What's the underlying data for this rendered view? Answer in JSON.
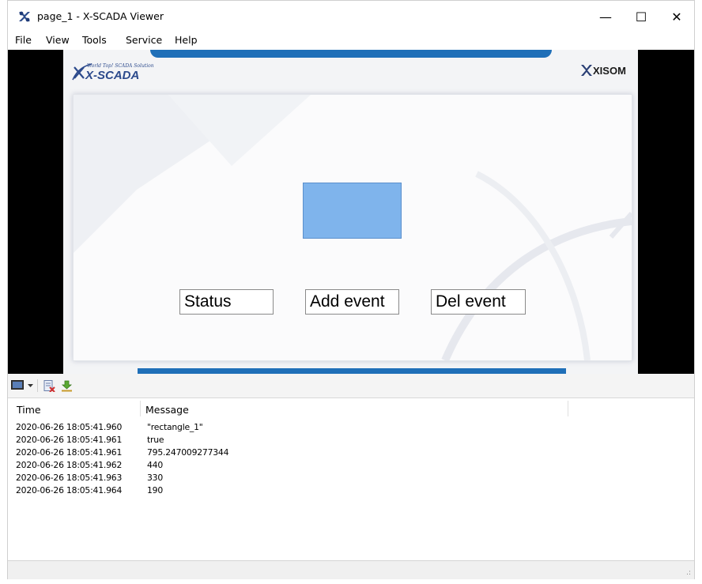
{
  "window": {
    "title": "page_1 - X-SCADA Viewer",
    "controls": {
      "minimize": "—",
      "maximize": "☐",
      "close": "✕"
    }
  },
  "menu": [
    "File",
    "View",
    "Tools",
    "Service",
    "Help"
  ],
  "hmi": {
    "logo_left": "X-SCADA",
    "logo_left_tagline": "World Top! SCADA Solution",
    "logo_right": "XISOM",
    "buttons": {
      "status": "Status",
      "add_event": "Add event",
      "del_event": "Del event"
    },
    "colors": {
      "accent_bar": "#1f6fb8",
      "rectangle_fill": "#7fb4ec"
    }
  },
  "toolbar": {
    "icons": [
      "monitor-icon",
      "dropdown-arrow-icon",
      "clear-log-icon",
      "download-icon"
    ]
  },
  "log": {
    "columns": [
      "Time",
      "Message"
    ],
    "rows": [
      {
        "time": "2020-06-26 18:05:41.960",
        "message": "\"rectangle_1\""
      },
      {
        "time": "2020-06-26 18:05:41.961",
        "message": "true"
      },
      {
        "time": "2020-06-26 18:05:41.961",
        "message": "795.247009277344"
      },
      {
        "time": "2020-06-26 18:05:41.962",
        "message": "440"
      },
      {
        "time": "2020-06-26 18:05:41.963",
        "message": "330"
      },
      {
        "time": "2020-06-26 18:05:41.964",
        "message": "190"
      }
    ]
  }
}
